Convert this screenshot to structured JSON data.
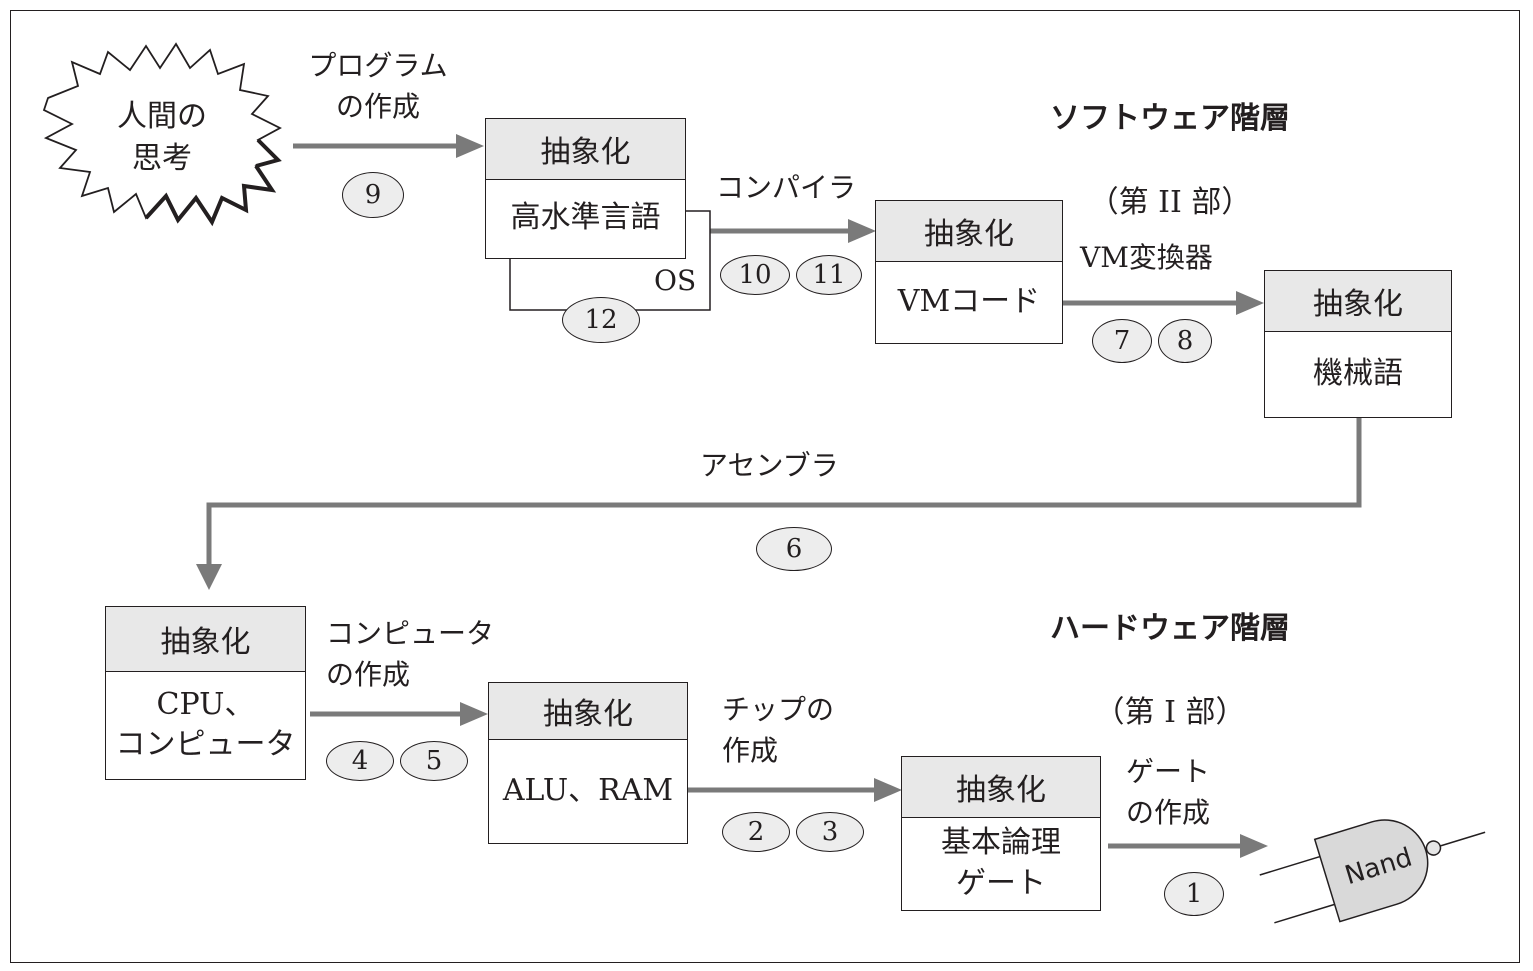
{
  "thought": "人間の\n思考",
  "layers": {
    "software_title": "ソフトウェア階層",
    "software_sub": "（第 II 部）",
    "hardware_title": "ハードウェア階層",
    "hardware_sub": "（第 I 部）"
  },
  "boxes": {
    "hll": {
      "header": "抽象化",
      "body": "高水準言語"
    },
    "vm": {
      "header": "抽象化",
      "body": "VMコード"
    },
    "machine": {
      "header": "抽象化",
      "body": "機械語"
    },
    "cpu": {
      "header": "抽象化",
      "body": "CPU、\nコンピュータ"
    },
    "alu": {
      "header": "抽象化",
      "body": "ALU、RAM"
    },
    "gates": {
      "header": "抽象化",
      "body": "基本論理\nゲート"
    }
  },
  "os_label": "OS",
  "arrows": {
    "program": "プログラム\nの作成",
    "compiler": "コンパイラ",
    "vm_translator": "VM変換器",
    "assembler": "アセンブラ",
    "computer": "コンピュータ\nの作成",
    "chips": "チップの\n作成",
    "gates": "ゲート\nの作成"
  },
  "badges": [
    "1",
    "2",
    "3",
    "4",
    "5",
    "6",
    "7",
    "8",
    "9",
    "10",
    "11",
    "12"
  ],
  "nand_label": "Nand"
}
